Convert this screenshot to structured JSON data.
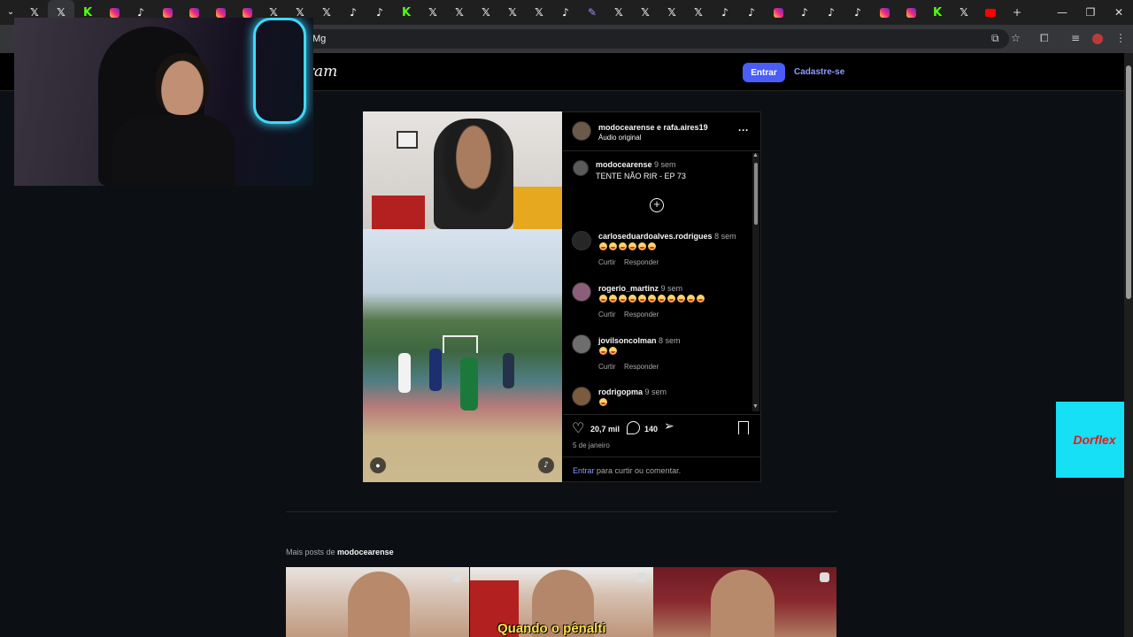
{
  "browser": {
    "tabs": [
      "x",
      "x-active",
      "kick",
      "instagram",
      "tiktok",
      "instagram",
      "instagram",
      "instagram",
      "instagram",
      "x",
      "x",
      "x",
      "tiktok",
      "tiktok",
      "kick",
      "x",
      "x",
      "x",
      "x",
      "x",
      "tiktok",
      "feather",
      "x",
      "x",
      "x",
      "x",
      "tiktok",
      "tiktok",
      "instagram",
      "tiktok",
      "tiktok",
      "tiktok",
      "instagram",
      "instagram",
      "kick",
      "x",
      "youtube"
    ],
    "new_tab_label": "+",
    "url": "Mg",
    "controls": {
      "minimize": "—",
      "restore": "❐",
      "close": "✕"
    }
  },
  "header": {
    "logo": "gram",
    "login_button": "Entrar",
    "signup_link": "Cadastre-se"
  },
  "post": {
    "header_user": "modocearense e rafa.aires19",
    "header_audio": "Áudio original",
    "caption_user": "modocearense",
    "caption_time": "9 sem",
    "caption_text": "TENTE NÃO RIR - EP 73",
    "comments": [
      {
        "user": "carloseduardoalves.rodrigues",
        "time": "8 sem",
        "emoji_count": 6,
        "like": "Curtir",
        "reply": "Responder"
      },
      {
        "user": "rogerio_martinz",
        "time": "9 sem",
        "emoji_count": 11,
        "like": "Curtir",
        "reply": "Responder"
      },
      {
        "user": "jovilsoncolman",
        "time": "8 sem",
        "emoji_count": 2,
        "like": "Curtir",
        "reply": "Responder"
      },
      {
        "user": "rodrigopma",
        "time": "9 sem",
        "emoji_count": 1
      }
    ],
    "likes": "20,7 mil",
    "comments_count": "140",
    "date": "5 de janeiro",
    "login_prompt_link": "Entrar",
    "login_prompt_rest": "para curtir ou comentar."
  },
  "more_posts": {
    "label": "Mais posts de",
    "user": "modocearense",
    "thumb_subtitle": "Quando o pênalti"
  },
  "ad": {
    "brand": "Dorflex"
  },
  "colors": {
    "accent": "#4a5df9",
    "link": "#8d9bff",
    "bg": "#0c1014",
    "ad_bg": "#16e0f5",
    "ad_text": "#e11d1d"
  }
}
